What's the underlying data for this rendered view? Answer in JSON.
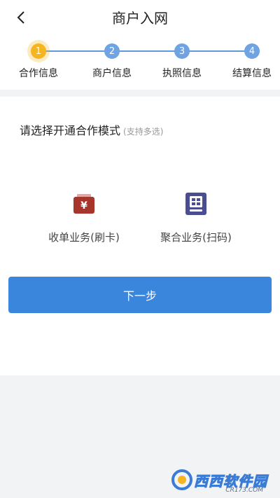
{
  "header": {
    "title": "商户入网"
  },
  "steps": [
    {
      "number": "1",
      "label": "合作信息",
      "active": true
    },
    {
      "number": "2",
      "label": "商户信息",
      "active": false
    },
    {
      "number": "3",
      "label": "执照信息",
      "active": false
    },
    {
      "number": "4",
      "label": "结算信息",
      "active": false
    }
  ],
  "prompt": {
    "text": "请选择开通合作模式",
    "note": "(支持多选)"
  },
  "options": [
    {
      "label": "收单业务(刷卡)",
      "icon": "wallet-yen-icon",
      "color": "#a8352b"
    },
    {
      "label": "聚合业务(扫码)",
      "icon": "qr-terminal-icon",
      "color": "#4a4d8f"
    }
  ],
  "actions": {
    "next_label": "下一步"
  },
  "colors": {
    "primary": "#3b86dd",
    "step": "#6fa3e2",
    "step_active": "#f5b521"
  },
  "watermark": {
    "text": "西西软件园",
    "sub": "CR173.COM"
  }
}
